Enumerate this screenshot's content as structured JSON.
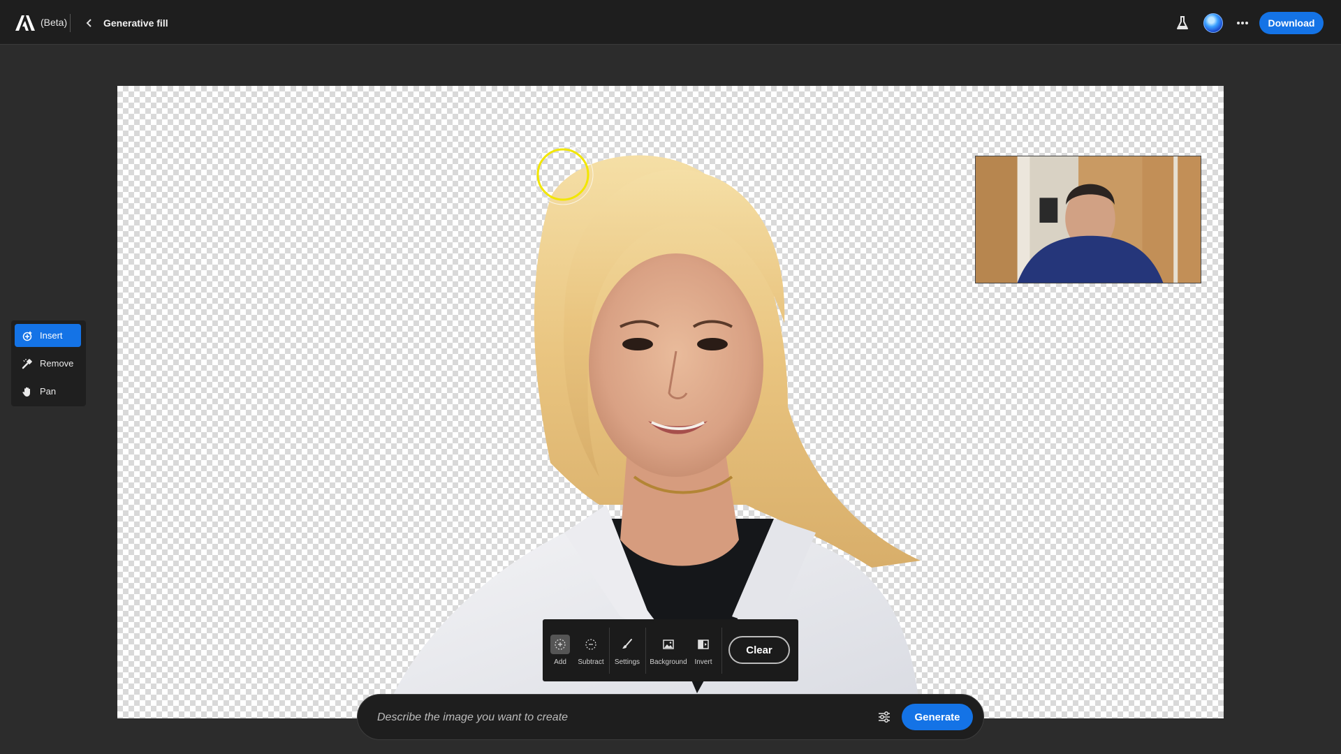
{
  "header": {
    "beta_label": "(Beta)",
    "breadcrumb": "Generative fill",
    "download_label": "Download"
  },
  "icons": {
    "logo": "adobe-logo-icon",
    "back": "chevron-left-icon",
    "labs": "flask-icon",
    "more": "more-horizontal-icon",
    "filters": "sliders-icon"
  },
  "left_tools": {
    "items": [
      {
        "label": "Insert",
        "active": true
      },
      {
        "label": "Remove",
        "active": false
      },
      {
        "label": "Pan",
        "active": false
      }
    ]
  },
  "selection_toolbar": {
    "add_label": "Add",
    "subtract_label": "Subtract",
    "settings_label": "Settings",
    "background_label": "Background",
    "invert_label": "Invert",
    "clear_label": "Clear"
  },
  "prompt": {
    "placeholder": "Describe the image you want to create",
    "value": "",
    "generate_label": "Generate"
  },
  "colors": {
    "accent": "#1473e6",
    "topbar": "#1e1e1e",
    "workspace": "#2c2c2c",
    "brush_cursor": "#f2e600"
  }
}
